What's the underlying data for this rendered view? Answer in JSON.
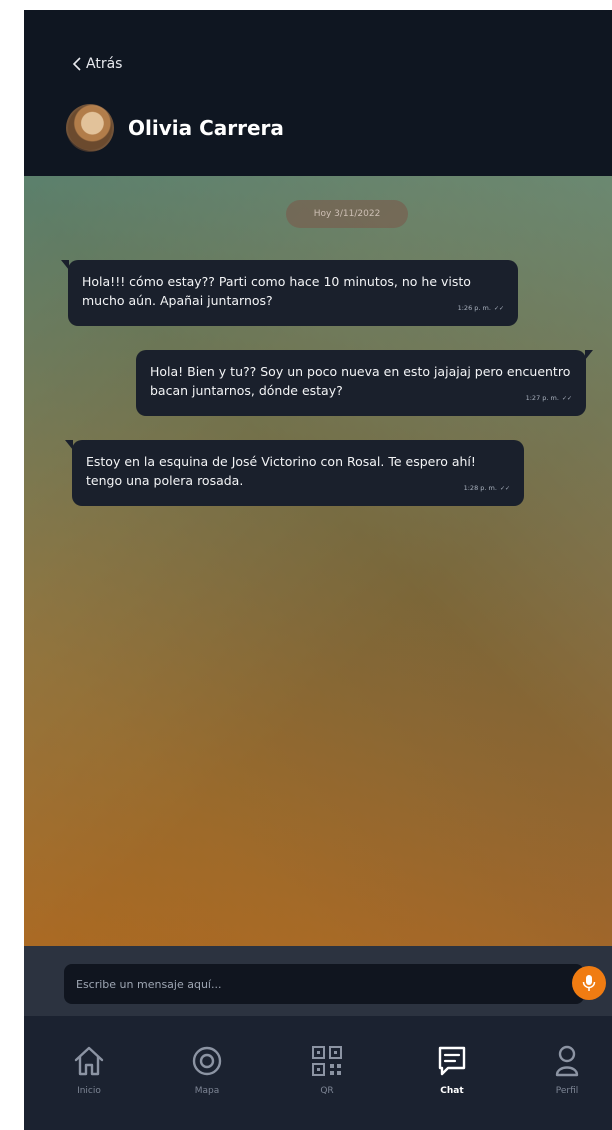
{
  "header": {
    "back_label": "Atrás",
    "contact_name": "Olivia Carrera"
  },
  "chat": {
    "date_label": "Hoy 3/11/2022",
    "messages": [
      {
        "direction": "incoming",
        "text": "Hola!!! cómo estay?? Parti como hace 10 minutos, no he visto mucho aún. Apañai juntarnos?",
        "time": "1:26 p. m."
      },
      {
        "direction": "outgoing",
        "text": "Hola! Bien y tu?? Soy un poco nueva en esto jajajaj pero encuentro bacan juntarnos, dónde estay?",
        "time": "1:27 p. m."
      },
      {
        "direction": "incoming",
        "text": "Estoy en la esquina de José Victorino con Rosal. Te espero ahí! tengo una polera rosada.",
        "time": "1:28 p. m."
      }
    ]
  },
  "composer": {
    "placeholder": "Escribe un mensaje aquí...",
    "mic_icon": "microphone-icon"
  },
  "nav": {
    "items": [
      {
        "label": "Inicio",
        "icon": "home-icon",
        "active": false
      },
      {
        "label": "Mapa",
        "icon": "target-icon",
        "active": false
      },
      {
        "label": "QR",
        "icon": "qr-code-icon",
        "active": false
      },
      {
        "label": "Chat",
        "icon": "chat-icon",
        "active": true
      },
      {
        "label": "Perfil",
        "icon": "user-icon",
        "active": false
      }
    ]
  },
  "colors": {
    "accent": "#f07c12",
    "bubble": "#1a202c",
    "header": "#0f1621",
    "nav": "#1b2230"
  }
}
